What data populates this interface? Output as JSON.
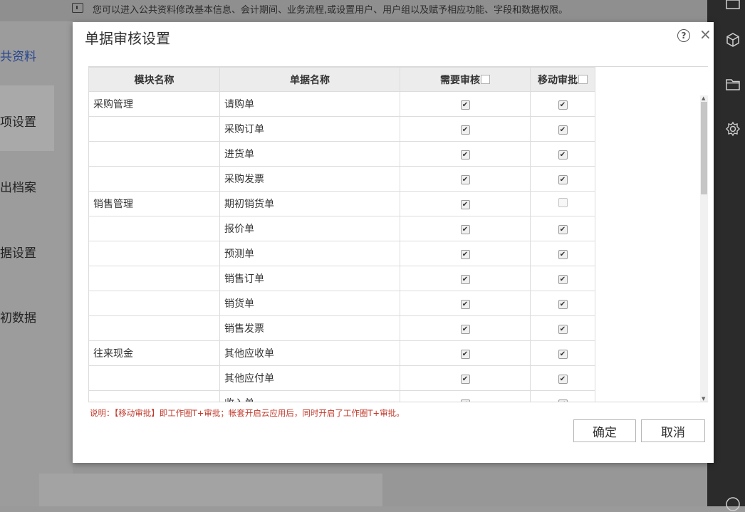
{
  "background": {
    "tip": "您可以进入公共资料修改基本信息、会计期间、业务流程,或设置用户、用户组以及赋予相应功能、字段和数据权限。",
    "left_items": [
      "共资料",
      "项设置",
      "出档案",
      "据设置",
      "初数据"
    ]
  },
  "dialog": {
    "title": "单据审核设置",
    "columns": [
      "模块名称",
      "单据名称",
      "需要审核",
      "移动审批"
    ],
    "rows": [
      {
        "module": "采购管理",
        "doc": "请购单",
        "audit": true,
        "mobile": true
      },
      {
        "module": "",
        "doc": "采购订单",
        "audit": true,
        "mobile": true
      },
      {
        "module": "",
        "doc": "进货单",
        "audit": true,
        "mobile": true
      },
      {
        "module": "",
        "doc": "采购发票",
        "audit": true,
        "mobile": true
      },
      {
        "module": "销售管理",
        "doc": "期初销货单",
        "audit": true,
        "mobile": false
      },
      {
        "module": "",
        "doc": "报价单",
        "audit": true,
        "mobile": true
      },
      {
        "module": "",
        "doc": "预测单",
        "audit": true,
        "mobile": true
      },
      {
        "module": "",
        "doc": "销售订单",
        "audit": true,
        "mobile": true
      },
      {
        "module": "",
        "doc": "销货单",
        "audit": true,
        "mobile": true
      },
      {
        "module": "",
        "doc": "销售发票",
        "audit": true,
        "mobile": true
      },
      {
        "module": "往来现金",
        "doc": "其他应收单",
        "audit": true,
        "mobile": true
      },
      {
        "module": "",
        "doc": "其他应付单",
        "audit": true,
        "mobile": true
      },
      {
        "module": "",
        "doc": "收入单",
        "audit": true,
        "mobile": true
      }
    ],
    "note": "说明：【移动审批】即工作圈T+审批；帐套开启云应用后，同时开启了工作圈T+审批。",
    "ok_label": "确定",
    "cancel_label": "取消",
    "check_glyph": "✔"
  }
}
